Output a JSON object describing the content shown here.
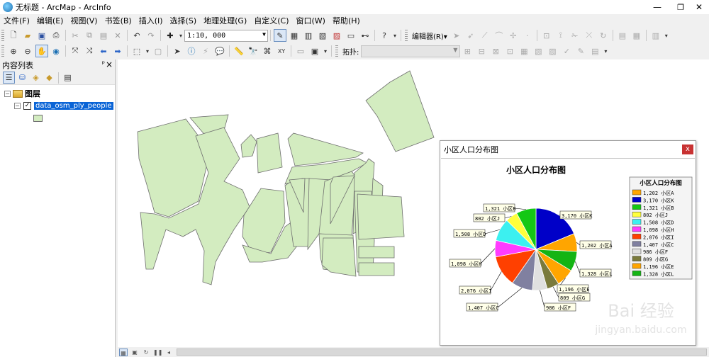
{
  "window": {
    "title": "无标题 - ArcMap - ArcInfo",
    "minimize": "—",
    "restore": "❐",
    "close": "✕"
  },
  "menu": [
    "文件(F)",
    "编辑(E)",
    "视图(V)",
    "书签(B)",
    "插入(I)",
    "选择(S)",
    "地理处理(G)",
    "自定义(C)",
    "窗口(W)",
    "帮助(H)"
  ],
  "toolbar1": {
    "scale_value": "1:10, 000",
    "editor_label": "编辑器(R)▾"
  },
  "toolbar2": {
    "topology_label": "拓扑:"
  },
  "toc": {
    "title": "内容列表",
    "pin": "ᵖ",
    "close": "×",
    "layers_group": "图层",
    "layer_name": "data_osm_ply_people",
    "layer_checked": true,
    "symbol_color": "#d3ecc0"
  },
  "map": {
    "polygon_fill": "#d3ecc0",
    "polygon_stroke": "#6e6e6e"
  },
  "chart_window": {
    "title": "小区人口分布图",
    "close_label": "x"
  },
  "chart_data": {
    "type": "pie",
    "title": "小区人口分布图",
    "legend_title": "小区人口分布图",
    "legend_placement": "right",
    "series": [
      {
        "name": "小区A",
        "value": 1202,
        "label": "1,202 小区A",
        "color": "#ffa500"
      },
      {
        "name": "小区K",
        "value": 3170,
        "label": "3,170 小区K",
        "color": "#0000c8"
      },
      {
        "name": "小区B",
        "value": 1321,
        "label": "1,321 小区B",
        "color": "#14c814"
      },
      {
        "name": "小区J",
        "value": 802,
        "label": "802 小区J",
        "color": "#ffff3c"
      },
      {
        "name": "小区D",
        "value": 1508,
        "label": "1,508 小区D",
        "color": "#3cf0f0"
      },
      {
        "name": "小区H",
        "value": 1098,
        "label": "1,098 小区H",
        "color": "#ff3cff"
      },
      {
        "name": "小区I",
        "value": 2076,
        "label": "2,076 小区I",
        "color": "#ff4000"
      },
      {
        "name": "小区C",
        "value": 1407,
        "label": "1,407 小区C",
        "color": "#8080a0"
      },
      {
        "name": "小区F",
        "value": 986,
        "label": "986 小区F",
        "color": "#e0e0e0"
      },
      {
        "name": "小区G",
        "value": 809,
        "label": "809 小区G",
        "color": "#7a7a3c"
      },
      {
        "name": "小区E",
        "value": 1196,
        "label": "1,196 小区E",
        "color": "#ffa500"
      },
      {
        "name": "小区L",
        "value": 1328,
        "label": "1,328 小区L",
        "color": "#14b414"
      }
    ],
    "pie_order": [
      "小区K",
      "小区A",
      "小区L",
      "小区E",
      "小区G",
      "小区F",
      "小区C",
      "小区I",
      "小区H",
      "小区D",
      "小区J",
      "小区B"
    ]
  },
  "watermark": {
    "text": "Bai 经验",
    "url": "jingyan.baidu.com"
  }
}
